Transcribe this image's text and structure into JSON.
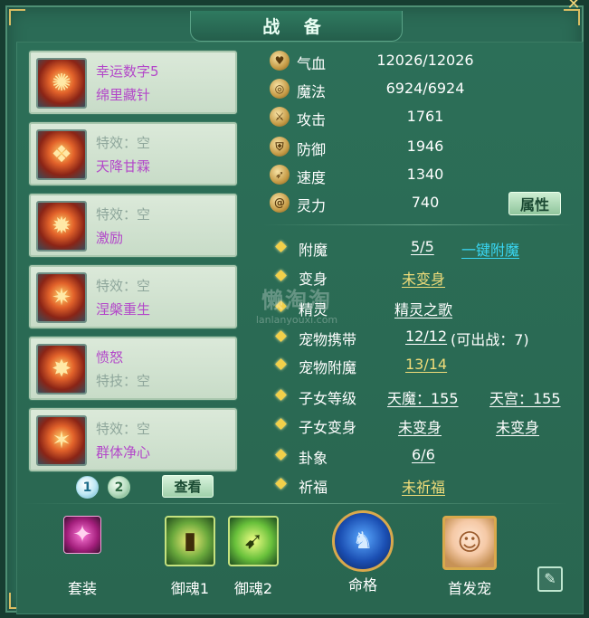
{
  "window": {
    "title": "战 备",
    "close_glyph": "✕"
  },
  "equipment": [
    {
      "icon": "fire-mask-icon",
      "line1": "幸运数字5",
      "line1_color": "purple",
      "line2": "绵里藏针",
      "line2_color": "purple"
    },
    {
      "icon": "wing-armor-icon",
      "line1": "特效：空",
      "line1_color": "gray",
      "line2": "天降甘霖",
      "line2_color": "purple"
    },
    {
      "icon": "flame-armor-icon",
      "line1": "特效：空",
      "line1_color": "gray",
      "line2": "激励",
      "line2_color": "purple"
    },
    {
      "icon": "crab-helm-icon",
      "line1": "特效：空",
      "line1_color": "gray",
      "line2": "涅槃重生",
      "line2_color": "purple"
    },
    {
      "icon": "fire-gauntlet-icon",
      "line1": "愤怒",
      "line1_color": "purple",
      "line2": "特技：空",
      "line2_color": "gray"
    },
    {
      "icon": "fire-boots-icon",
      "line1": "特效：空",
      "line1_color": "gray",
      "line2": "群体净心",
      "line2_color": "purple"
    }
  ],
  "pagination": {
    "page1": "1",
    "page2": "2",
    "view_label": "查看"
  },
  "stats": [
    {
      "icon": "heart-icon",
      "glyph": "♥",
      "label": "气血",
      "value": "12026/12026"
    },
    {
      "icon": "mana-swirl-icon",
      "glyph": "◎",
      "label": "魔法",
      "value": "6924/6924"
    },
    {
      "icon": "sword-icon",
      "glyph": "⚔",
      "label": "攻击",
      "value": "1761"
    },
    {
      "icon": "shield-icon",
      "glyph": "⛨",
      "label": "防御",
      "value": "1946"
    },
    {
      "icon": "boot-icon",
      "glyph": "➶",
      "label": "速度",
      "value": "1340"
    },
    {
      "icon": "spirit-swirl-icon",
      "glyph": "@",
      "label": "灵力",
      "value": "740"
    }
  ],
  "attr_button": "属性",
  "info": [
    {
      "label": "附魔",
      "v1": "5/5",
      "v1_color": "white",
      "v2": "一键附魔",
      "v2_color": "cyan",
      "v2_link": true
    },
    {
      "label": "变身",
      "v1": "未变身",
      "v1_color": "gold",
      "v2": ""
    },
    {
      "label": "精灵",
      "v1": "精灵之歌",
      "v1_color": "white",
      "v2": ""
    },
    {
      "label": "宠物携带",
      "v1": "12/12",
      "v1_color": "white",
      "v2": "(可出战：7)",
      "v2_color": "white"
    },
    {
      "label": "宠物附魔",
      "v1": "13/14",
      "v1_color": "gold",
      "v2": ""
    },
    {
      "label": "子女等级",
      "v1": "天魔：155",
      "v1_color": "white",
      "v2": "天宫：155",
      "v2_color": "white",
      "v2_link": true
    },
    {
      "label": "子女变身",
      "v1": "未变身",
      "v1_color": "white",
      "v2": "未变身",
      "v2_color": "white",
      "v2_link": true
    },
    {
      "label": "卦象",
      "v1": "6/6",
      "v1_color": "white",
      "v2": ""
    },
    {
      "label": "祈福",
      "v1": "未祈福",
      "v1_color": "gold",
      "v2": ""
    }
  ],
  "bottom": [
    {
      "icon": "suit-icon",
      "glyph": "✦",
      "label": "套装"
    },
    {
      "icon": "soul-scroll-icon",
      "glyph": "▮",
      "label": "御魂1"
    },
    {
      "icon": "soul-swirl-icon",
      "glyph": "➹",
      "label": "御魂2"
    },
    {
      "icon": "fate-warrior-icon",
      "glyph": "♞",
      "label": "命格"
    },
    {
      "icon": "pet-portrait-icon",
      "glyph": "☺",
      "label": "首发宠"
    }
  ],
  "edit_glyph": "✎",
  "watermark": {
    "big": "懒淘淘",
    "small": "lanlanyouxi.com"
  }
}
